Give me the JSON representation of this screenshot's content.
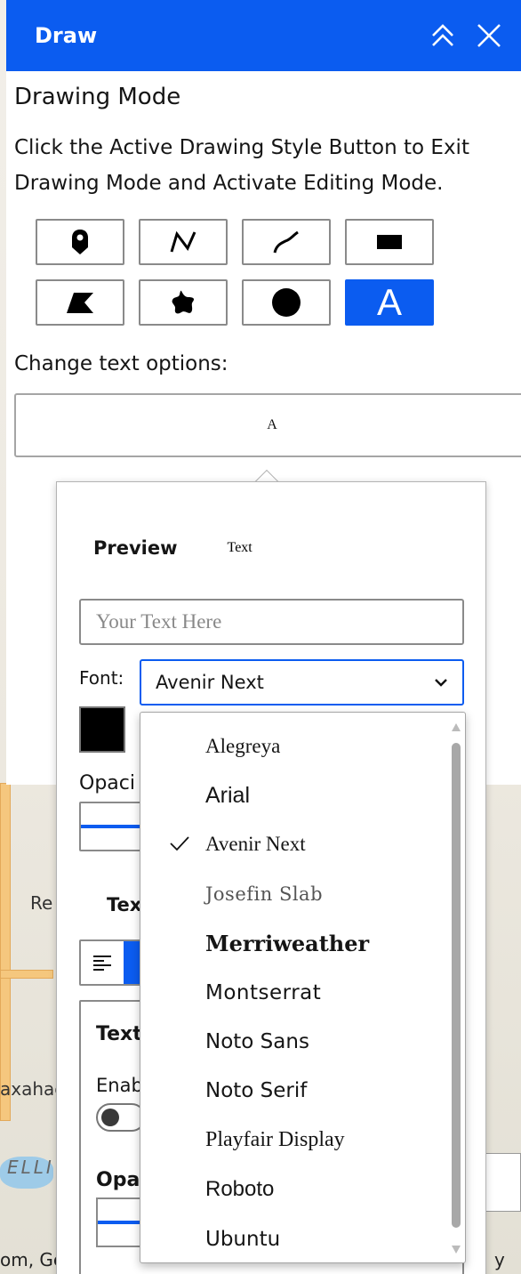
{
  "panel": {
    "title": "Draw",
    "mode_title": "Drawing Mode",
    "mode_hint": "Click the Active Drawing Style Button to Exit Drawing Mode and Activate Editing Mode.",
    "tools": [
      {
        "name": "point",
        "icon": "map-pin-icon",
        "active": false
      },
      {
        "name": "polyline",
        "icon": "polyline-icon",
        "active": false
      },
      {
        "name": "freehand-polyline",
        "icon": "freehand-line-icon",
        "active": false
      },
      {
        "name": "rectangle",
        "icon": "rectangle-icon",
        "active": false
      },
      {
        "name": "polygon",
        "icon": "polygon-icon",
        "active": false
      },
      {
        "name": "freehand-polygon",
        "icon": "freehand-polygon-icon",
        "active": false
      },
      {
        "name": "circle",
        "icon": "circle-icon",
        "active": false
      },
      {
        "name": "text",
        "icon": "text-icon",
        "active": true,
        "glyph": "A"
      }
    ],
    "text_options_label": "Change text options:",
    "text_options_button": "A",
    "accent_color": "#0b5cf0"
  },
  "text_popover": {
    "preview_label": "Preview",
    "preview_text": "Text",
    "input_placeholder": "Your Text Here",
    "font_label": "Font:",
    "font_selected": "Avenir Next",
    "color_value": "#000000",
    "opacity_label": "Opaci",
    "text_align_label": "Text",
    "halo_title": "Text",
    "halo_enable_label": "Enab",
    "halo_opacity_label": "Opa"
  },
  "font_dropdown": {
    "options": [
      {
        "label": "Alegreya",
        "selected": false
      },
      {
        "label": "Arial",
        "selected": false
      },
      {
        "label": "Avenir Next",
        "selected": true
      },
      {
        "label": "Josefin Slab",
        "selected": false
      },
      {
        "label": "Merriweather",
        "selected": false
      },
      {
        "label": "Montserrat",
        "selected": false
      },
      {
        "label": "Noto Sans",
        "selected": false
      },
      {
        "label": "Noto Serif",
        "selected": false
      },
      {
        "label": "Playfair Display",
        "selected": false
      },
      {
        "label": "Roboto",
        "selected": false
      },
      {
        "label": "Ubuntu",
        "selected": false
      }
    ]
  },
  "map": {
    "labels": [
      "Re",
      "axahac",
      "ELLI"
    ],
    "attribution_left": "om, Ge",
    "attribution_right": "y Esri"
  }
}
